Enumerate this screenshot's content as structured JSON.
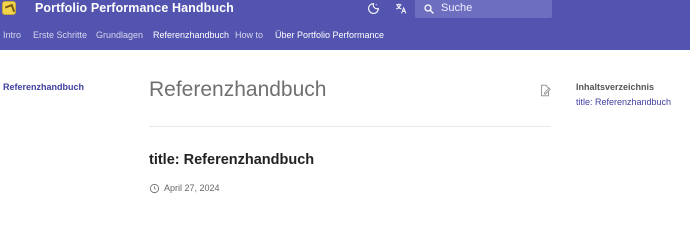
{
  "header": {
    "title": "Portfolio Performance Handbuch",
    "search_placeholder": "Suche",
    "color": "#5353b0"
  },
  "icons": {
    "logo": "logo-icon",
    "theme": "dark-mode-icon",
    "language": "translate-icon",
    "search": "search-icon",
    "edit": "edit-page-icon",
    "date": "clock-icon"
  },
  "tabs": [
    {
      "label": "Intro"
    },
    {
      "label": "Erste Schritte"
    },
    {
      "label": "Grundlagen"
    },
    {
      "label": "Referenzhandbuch",
      "active": true
    },
    {
      "label": "How to"
    },
    {
      "label": "Über Portfolio Performance"
    }
  ],
  "nav": {
    "active_item": "Referenzhandbuch"
  },
  "main": {
    "page_title": "Referenzhandbuch",
    "content_title": "title: Referenzhandbuch",
    "date": "April 27, 2024"
  },
  "toc": {
    "heading": "Inhaltsverzeichnis",
    "items": [
      "title: Referenzhandbuch"
    ]
  },
  "colors": {
    "accent": "#3f3fa0"
  }
}
